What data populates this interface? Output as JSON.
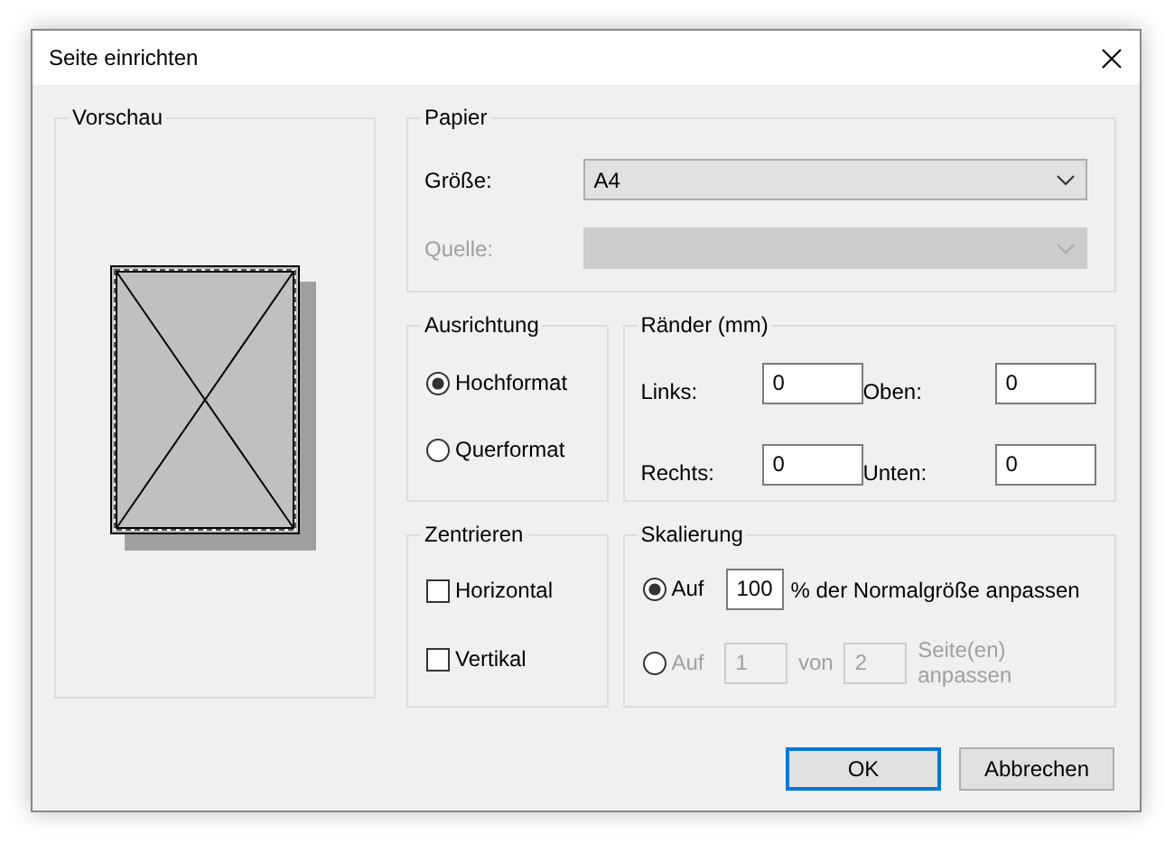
{
  "window": {
    "title": "Seite einrichten"
  },
  "preview": {
    "title": "Vorschau"
  },
  "paper": {
    "title": "Papier",
    "fields": [
      {
        "label": "Größe:",
        "value": "A4",
        "disabled": false
      },
      {
        "label": "Quelle:",
        "disabled": true
      }
    ]
  },
  "orientation": {
    "title": "Ausrichtung",
    "options": [
      {
        "label": "Hochformat",
        "selected": true
      },
      {
        "label": "Querformat",
        "selected": false
      }
    ]
  },
  "margins": {
    "title": "Ränder (mm)",
    "fields": [
      {
        "label": "Links:",
        "value": "0"
      },
      {
        "label": "Oben:",
        "value": "0"
      },
      {
        "label": "Rechts:",
        "value": "0"
      },
      {
        "label": "Unten:",
        "value": "0"
      }
    ]
  },
  "centering": {
    "title": "Zentrieren",
    "options": [
      {
        "label": "Horizontal",
        "checked": false
      },
      {
        "label": "Vertikal",
        "checked": false
      }
    ]
  },
  "scaling": {
    "title": "Skalierung",
    "options": [
      {
        "kind": "percent",
        "label": "Auf",
        "selected": true,
        "disabled": false,
        "value": "100",
        "suffix": "% der Normalgröße anpassen"
      },
      {
        "kind": "pages",
        "label": "Auf",
        "selected": false,
        "disabled": true,
        "value": "1",
        "middle": "von",
        "value2": "2",
        "suffix": "Seite(en) anpassen"
      }
    ]
  },
  "buttons": [
    {
      "label": "OK",
      "default": true
    },
    {
      "label": "Abbrechen",
      "default": false
    }
  ]
}
